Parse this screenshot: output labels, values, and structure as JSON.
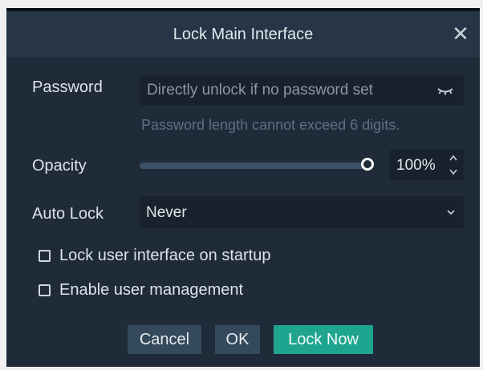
{
  "dialog": {
    "title": "Lock Main Interface",
    "close_icon": "close-icon"
  },
  "password": {
    "label": "Password",
    "placeholder": "Directly unlock if no password set",
    "value": "",
    "toggle_icon": "eye-closed-icon",
    "hint": "Password length cannot exceed 6 digits."
  },
  "opacity": {
    "label": "Opacity",
    "level": 1.0,
    "value_text": "100%"
  },
  "auto_lock": {
    "label": "Auto Lock",
    "selected": "Never"
  },
  "options": [
    {
      "label": "Lock user interface on startup",
      "checked": false
    },
    {
      "label": "Enable user management",
      "checked": false
    }
  ],
  "buttons": {
    "cancel": "Cancel",
    "ok": "OK",
    "lock_now": "Lock Now"
  },
  "colors": {
    "background": "#1f2b38",
    "titlebar": "#263646",
    "field": "#18222d",
    "accent": "#1fa58f",
    "secondary_button": "#34495c"
  }
}
